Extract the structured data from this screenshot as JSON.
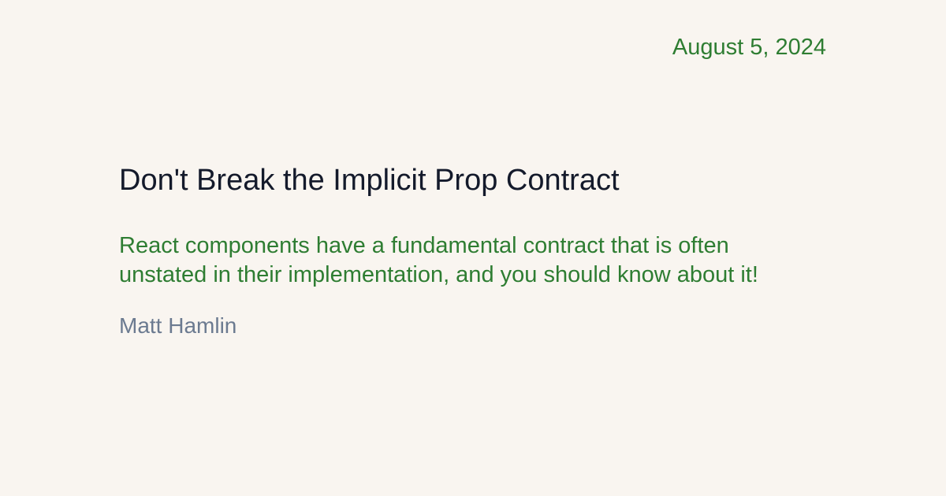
{
  "post": {
    "date": "August 5, 2024",
    "title": "Don't Break the Implicit Prop Contract",
    "description": "React components have a fundamental contract that is often unstated in their implementation, and you should know about it!",
    "author": "Matt Hamlin"
  },
  "colors": {
    "background": "#f9f5f0",
    "accent": "#2e7d32",
    "title": "#141a2b",
    "author": "#6b7a90"
  }
}
